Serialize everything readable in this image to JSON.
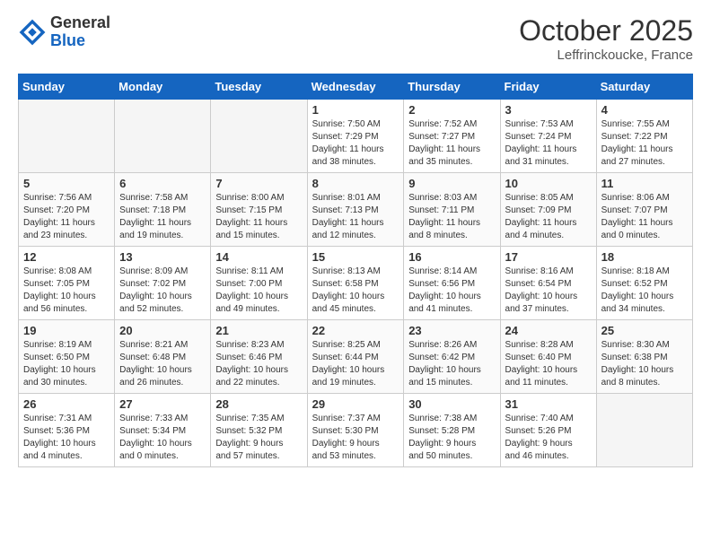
{
  "header": {
    "logo_general": "General",
    "logo_blue": "Blue",
    "month_title": "October 2025",
    "location": "Leffrinckoucke, France"
  },
  "weekdays": [
    "Sunday",
    "Monday",
    "Tuesday",
    "Wednesday",
    "Thursday",
    "Friday",
    "Saturday"
  ],
  "weeks": [
    [
      {
        "day": "",
        "info": ""
      },
      {
        "day": "",
        "info": ""
      },
      {
        "day": "",
        "info": ""
      },
      {
        "day": "1",
        "info": "Sunrise: 7:50 AM\nSunset: 7:29 PM\nDaylight: 11 hours\nand 38 minutes."
      },
      {
        "day": "2",
        "info": "Sunrise: 7:52 AM\nSunset: 7:27 PM\nDaylight: 11 hours\nand 35 minutes."
      },
      {
        "day": "3",
        "info": "Sunrise: 7:53 AM\nSunset: 7:24 PM\nDaylight: 11 hours\nand 31 minutes."
      },
      {
        "day": "4",
        "info": "Sunrise: 7:55 AM\nSunset: 7:22 PM\nDaylight: 11 hours\nand 27 minutes."
      }
    ],
    [
      {
        "day": "5",
        "info": "Sunrise: 7:56 AM\nSunset: 7:20 PM\nDaylight: 11 hours\nand 23 minutes."
      },
      {
        "day": "6",
        "info": "Sunrise: 7:58 AM\nSunset: 7:18 PM\nDaylight: 11 hours\nand 19 minutes."
      },
      {
        "day": "7",
        "info": "Sunrise: 8:00 AM\nSunset: 7:15 PM\nDaylight: 11 hours\nand 15 minutes."
      },
      {
        "day": "8",
        "info": "Sunrise: 8:01 AM\nSunset: 7:13 PM\nDaylight: 11 hours\nand 12 minutes."
      },
      {
        "day": "9",
        "info": "Sunrise: 8:03 AM\nSunset: 7:11 PM\nDaylight: 11 hours\nand 8 minutes."
      },
      {
        "day": "10",
        "info": "Sunrise: 8:05 AM\nSunset: 7:09 PM\nDaylight: 11 hours\nand 4 minutes."
      },
      {
        "day": "11",
        "info": "Sunrise: 8:06 AM\nSunset: 7:07 PM\nDaylight: 11 hours\nand 0 minutes."
      }
    ],
    [
      {
        "day": "12",
        "info": "Sunrise: 8:08 AM\nSunset: 7:05 PM\nDaylight: 10 hours\nand 56 minutes."
      },
      {
        "day": "13",
        "info": "Sunrise: 8:09 AM\nSunset: 7:02 PM\nDaylight: 10 hours\nand 52 minutes."
      },
      {
        "day": "14",
        "info": "Sunrise: 8:11 AM\nSunset: 7:00 PM\nDaylight: 10 hours\nand 49 minutes."
      },
      {
        "day": "15",
        "info": "Sunrise: 8:13 AM\nSunset: 6:58 PM\nDaylight: 10 hours\nand 45 minutes."
      },
      {
        "day": "16",
        "info": "Sunrise: 8:14 AM\nSunset: 6:56 PM\nDaylight: 10 hours\nand 41 minutes."
      },
      {
        "day": "17",
        "info": "Sunrise: 8:16 AM\nSunset: 6:54 PM\nDaylight: 10 hours\nand 37 minutes."
      },
      {
        "day": "18",
        "info": "Sunrise: 8:18 AM\nSunset: 6:52 PM\nDaylight: 10 hours\nand 34 minutes."
      }
    ],
    [
      {
        "day": "19",
        "info": "Sunrise: 8:19 AM\nSunset: 6:50 PM\nDaylight: 10 hours\nand 30 minutes."
      },
      {
        "day": "20",
        "info": "Sunrise: 8:21 AM\nSunset: 6:48 PM\nDaylight: 10 hours\nand 26 minutes."
      },
      {
        "day": "21",
        "info": "Sunrise: 8:23 AM\nSunset: 6:46 PM\nDaylight: 10 hours\nand 22 minutes."
      },
      {
        "day": "22",
        "info": "Sunrise: 8:25 AM\nSunset: 6:44 PM\nDaylight: 10 hours\nand 19 minutes."
      },
      {
        "day": "23",
        "info": "Sunrise: 8:26 AM\nSunset: 6:42 PM\nDaylight: 10 hours\nand 15 minutes."
      },
      {
        "day": "24",
        "info": "Sunrise: 8:28 AM\nSunset: 6:40 PM\nDaylight: 10 hours\nand 11 minutes."
      },
      {
        "day": "25",
        "info": "Sunrise: 8:30 AM\nSunset: 6:38 PM\nDaylight: 10 hours\nand 8 minutes."
      }
    ],
    [
      {
        "day": "26",
        "info": "Sunrise: 7:31 AM\nSunset: 5:36 PM\nDaylight: 10 hours\nand 4 minutes."
      },
      {
        "day": "27",
        "info": "Sunrise: 7:33 AM\nSunset: 5:34 PM\nDaylight: 10 hours\nand 0 minutes."
      },
      {
        "day": "28",
        "info": "Sunrise: 7:35 AM\nSunset: 5:32 PM\nDaylight: 9 hours\nand 57 minutes."
      },
      {
        "day": "29",
        "info": "Sunrise: 7:37 AM\nSunset: 5:30 PM\nDaylight: 9 hours\nand 53 minutes."
      },
      {
        "day": "30",
        "info": "Sunrise: 7:38 AM\nSunset: 5:28 PM\nDaylight: 9 hours\nand 50 minutes."
      },
      {
        "day": "31",
        "info": "Sunrise: 7:40 AM\nSunset: 5:26 PM\nDaylight: 9 hours\nand 46 minutes."
      },
      {
        "day": "",
        "info": ""
      }
    ]
  ]
}
